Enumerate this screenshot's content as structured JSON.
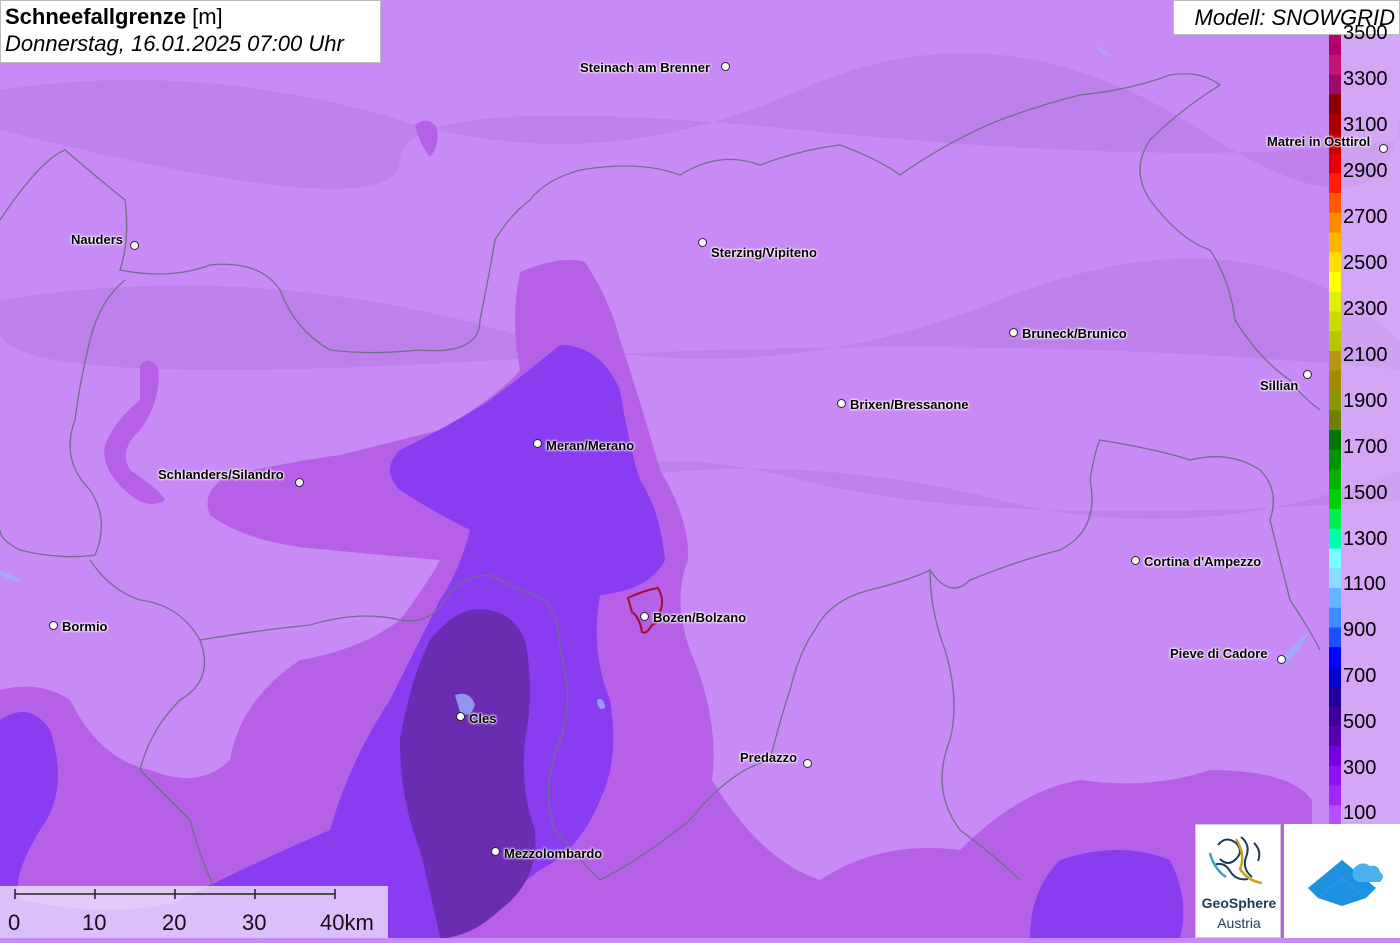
{
  "header": {
    "title_bold": "Schneefallgrenze",
    "title_unit": "[m]",
    "datetime": "Donnerstag, 16.01.2025 07:00 Uhr",
    "model": "Modell: SNOWGRID"
  },
  "legend": {
    "labels": [
      "3500",
      "3300",
      "3100",
      "2900",
      "2700",
      "2500",
      "2300",
      "2100",
      "1900",
      "1700",
      "1500",
      "1300",
      "1100",
      "900",
      "700",
      "500",
      "300",
      "100"
    ],
    "colors": [
      "#b4006e",
      "#c81478",
      "#a00a64",
      "#8c0000",
      "#aa0000",
      "#c80000",
      "#e60000",
      "#ff1e00",
      "#ff5a00",
      "#ff8c00",
      "#ffb400",
      "#ffdc00",
      "#ffff00",
      "#dcf000",
      "#c8dc00",
      "#b4c800",
      "#b49614",
      "#a08c00",
      "#8c9600",
      "#6e8200",
      "#007800",
      "#009600",
      "#00b400",
      "#00d200",
      "#00f050",
      "#00ffaa",
      "#78ffff",
      "#8cdcff",
      "#64b4ff",
      "#3c8cff",
      "#1e50ff",
      "#0000ff",
      "#0000c8",
      "#1e0096",
      "#3c0096",
      "#5a00b4",
      "#7800dc",
      "#8c14f0",
      "#a028f5",
      "#b450ff"
    ],
    "colors_note": "top-to-bottom swatch colors"
  },
  "places": [
    {
      "name": "Steinach am Brenner",
      "side": "left"
    },
    {
      "name": "Nauders",
      "side": "left"
    },
    {
      "name": "Sterzing/Vipiteno",
      "side": "right"
    },
    {
      "name": "Matrei in Osttirol",
      "side": "left"
    },
    {
      "name": "Bruneck/Brunico",
      "side": "right"
    },
    {
      "name": "Sillian",
      "side": "left"
    },
    {
      "name": "Brixen/Bressanone",
      "side": "right"
    },
    {
      "name": "Meran/Merano",
      "side": "right"
    },
    {
      "name": "Schlanders/Silandro",
      "side": "left"
    },
    {
      "name": "Cortina d'Ampezzo",
      "side": "right"
    },
    {
      "name": "Bormio",
      "side": "right"
    },
    {
      "name": "Bozen/Bolzano",
      "side": "right"
    },
    {
      "name": "Pieve di Cadore",
      "side": "left"
    },
    {
      "name": "Cles",
      "side": "right"
    },
    {
      "name": "Predazzo",
      "side": "left"
    },
    {
      "name": "Mezzolombardo",
      "side": "right"
    }
  ],
  "scale": {
    "labels": [
      "0",
      "10",
      "20",
      "30",
      "40km"
    ]
  },
  "logos": {
    "geosphere_line1": "GeoSphere",
    "geosphere_line2": "Austria"
  },
  "colors": {
    "map_base": "#c88af5",
    "zone_magenta": "#b660e8",
    "zone_violet": "#8a3cf0",
    "zone_dark": "#6a2cb0",
    "border": "#6e6e8c"
  }
}
